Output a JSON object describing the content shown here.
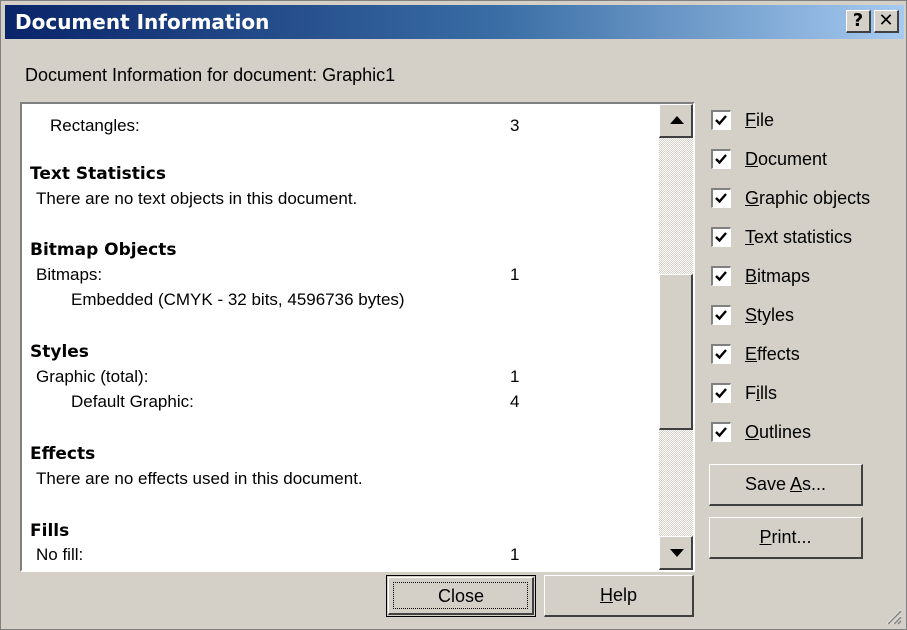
{
  "window": {
    "title": "Document Information",
    "help_button_label": "?",
    "close_button_label": "✕"
  },
  "subtitle": "Document Information for document: Graphic1",
  "list": {
    "rectangles_label": "Rectangles:",
    "rectangles_value": "3",
    "text_stats_heading": "Text Statistics",
    "text_stats_note": "There are no text objects in this document.",
    "bitmap_heading": "Bitmap Objects",
    "bitmaps_label": "Bitmaps:",
    "bitmaps_value": "1",
    "embedded_text": "Embedded (CMYK - 32 bits, 4596736 bytes)",
    "styles_heading": "Styles",
    "graphic_total_label": "Graphic (total):",
    "graphic_total_value": "1",
    "default_graphic_label": "Default Graphic:",
    "default_graphic_value": "4",
    "effects_heading": "Effects",
    "effects_note": "There are no effects used in this document.",
    "fills_heading": "Fills",
    "no_fill_label": "No fill:",
    "no_fill_value": "1"
  },
  "options": [
    {
      "mnemonic": "F",
      "rest": "ile",
      "checked": true
    },
    {
      "mnemonic": "D",
      "rest": "ocument",
      "checked": true
    },
    {
      "mnemonic": "G",
      "rest": "raphic objects",
      "checked": true
    },
    {
      "mnemonic": "T",
      "rest": "ext statistics",
      "checked": true
    },
    {
      "mnemonic": "B",
      "rest": "itmaps",
      "checked": true
    },
    {
      "mnemonic": "S",
      "rest": "tyles",
      "checked": true
    },
    {
      "mnemonic": "E",
      "rest": "ffects",
      "checked": true
    },
    {
      "prefix": "F",
      "mnemonic": "i",
      "rest": "lls",
      "checked": true
    },
    {
      "mnemonic": "O",
      "rest": "utlines",
      "checked": true
    }
  ],
  "buttons": {
    "save_as_prefix": "Save ",
    "save_as_mnemonic": "A",
    "save_as_rest": "s...",
    "print_mnemonic": "P",
    "print_rest": "rint...",
    "close_label": "Close",
    "help_mnemonic": "H",
    "help_rest": "elp"
  },
  "icons": {
    "scroll_up": "arrow-up-icon",
    "scroll_down": "arrow-down-icon",
    "check": "checkmark-icon",
    "grip": "resize-grip-icon"
  }
}
